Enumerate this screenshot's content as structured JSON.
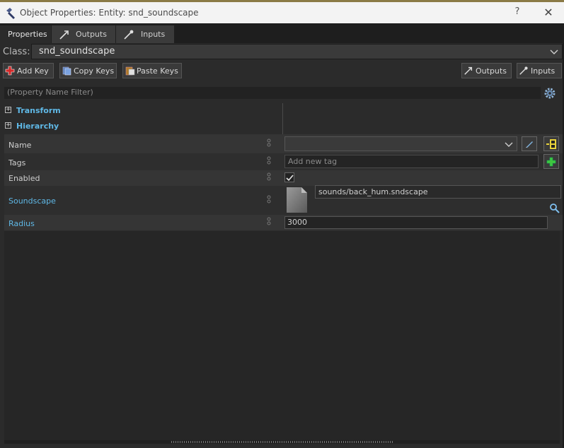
{
  "window": {
    "title": "Object Properties: Entity: snd_soundscape",
    "help": "?",
    "close": "✕"
  },
  "tabs": [
    {
      "label": "Properties",
      "active": true
    },
    {
      "label": "Outputs",
      "active": false
    },
    {
      "label": "Inputs",
      "active": false
    }
  ],
  "class_row": {
    "label": "Class:",
    "value": "snd_soundscape"
  },
  "toolbar": {
    "add_key": "Add Key",
    "copy_keys": "Copy Keys",
    "paste_keys": "Paste Keys",
    "outputs": "Outputs",
    "inputs": "Inputs"
  },
  "filter": {
    "placeholder": "(Property Name Filter)"
  },
  "sections": [
    {
      "label": "Transform",
      "expand_symbol": "+"
    },
    {
      "label": "Hierarchy",
      "expand_symbol": "+"
    }
  ],
  "properties": {
    "name": {
      "label": "Name",
      "value": ""
    },
    "tags": {
      "label": "Tags",
      "placeholder": "Add new tag"
    },
    "enabled": {
      "label": "Enabled",
      "checked": true
    },
    "soundscape": {
      "label": "Soundscape",
      "value": "sounds/back_hum.sndscape"
    },
    "radius": {
      "label": "Radius",
      "value": "3000"
    }
  },
  "colors": {
    "panel": "#2b2b2b",
    "titlebar": "#f3f3f3",
    "accent_label": "#5fb8e6",
    "add_red": "#d42a2a",
    "add_green": "#3fc63f",
    "pick_yellow": "#e8d23a"
  },
  "icons": [
    "hammer-icon",
    "outputs-arrow-icon",
    "inputs-arrow-icon",
    "add-key-icon",
    "copy-icon",
    "paste-icon",
    "gear-icon",
    "expand-plus-icon",
    "pin-icon",
    "chevron-down-icon",
    "pencil-icon",
    "entity-picker-icon",
    "add-tag-icon",
    "file-icon",
    "asset-search-icon",
    "checkmark-icon"
  ]
}
